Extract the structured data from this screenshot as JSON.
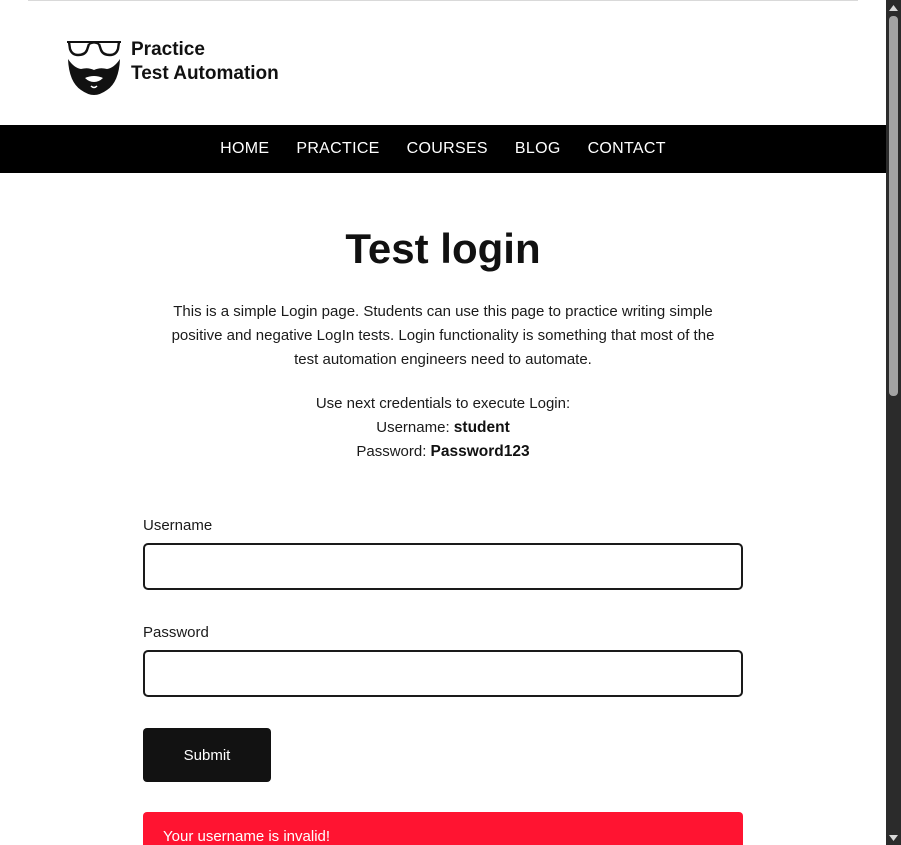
{
  "header": {
    "logo_line1": "Practice",
    "logo_line2": "Test Automation",
    "logo_icon": "bearded-face-glasses-icon"
  },
  "nav": {
    "items": [
      {
        "label": "HOME"
      },
      {
        "label": "PRACTICE"
      },
      {
        "label": "COURSES"
      },
      {
        "label": "BLOG"
      },
      {
        "label": "CONTACT"
      }
    ]
  },
  "main": {
    "title": "Test login",
    "intro": "This is a simple Login page. Students can use this page to practice writing simple positive and negative LogIn tests. Login functionality is something that most of the test automation engineers need to automate.",
    "credentials": {
      "heading": "Use next credentials to execute Login:",
      "username_label": "Username:",
      "username_value": "student",
      "password_label": "Password:",
      "password_value": "Password123"
    }
  },
  "form": {
    "username_label": "Username",
    "username_value": "",
    "password_label": "Password",
    "password_value": "",
    "submit_label": "Submit"
  },
  "error": {
    "message": "Your username is invalid!"
  },
  "colors": {
    "nav_background": "#000000",
    "button_background": "#121212",
    "error_background": "#ff1431",
    "text": "#1a1a1a"
  }
}
